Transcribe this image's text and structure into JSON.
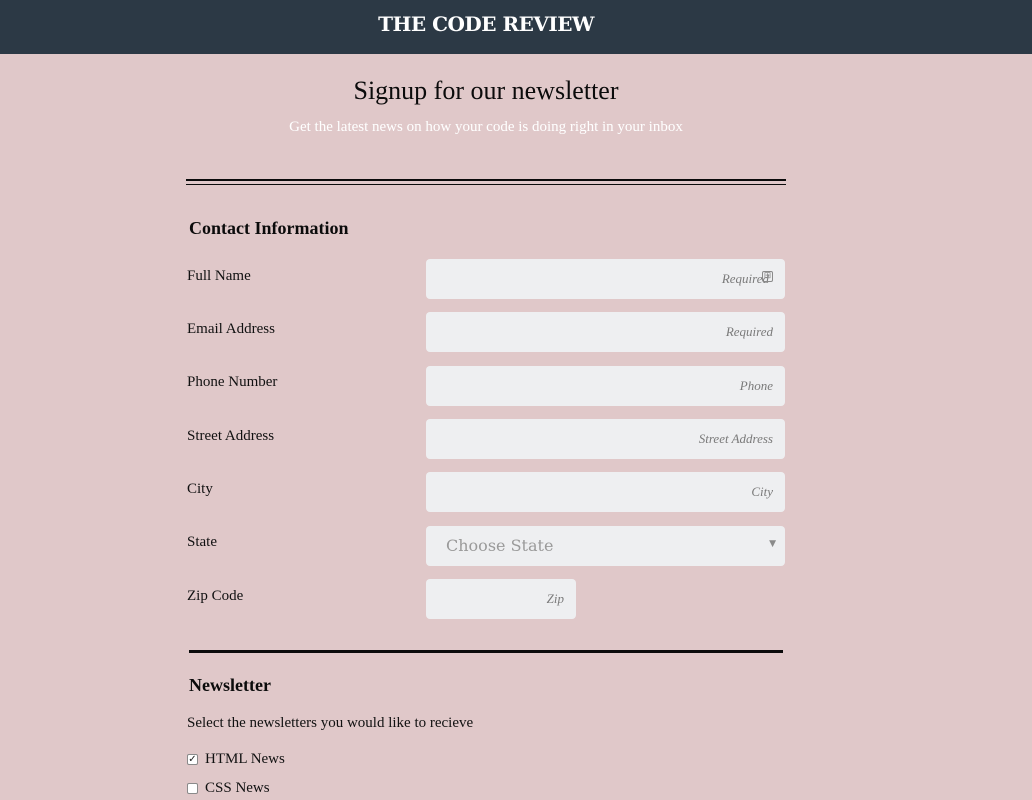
{
  "header": {
    "brand": "THE CODE REVIEW"
  },
  "hero": {
    "title": "Signup for our newsletter",
    "subtitle": "Get the latest news on how your code is doing right in your inbox"
  },
  "contact": {
    "title": "Contact Information",
    "fields": {
      "full_name": {
        "label": "Full Name",
        "placeholder": "Required"
      },
      "email": {
        "label": "Email Address",
        "placeholder": "Required"
      },
      "phone": {
        "label": "Phone Number",
        "placeholder": "Phone"
      },
      "street": {
        "label": "Street Address",
        "placeholder": "Street Address"
      },
      "city": {
        "label": "City",
        "placeholder": "City"
      },
      "state": {
        "label": "State",
        "selected": "Choose State"
      },
      "zip": {
        "label": "Zip Code",
        "placeholder": "Zip"
      }
    }
  },
  "newsletter": {
    "title": "Newsletter",
    "prompt": "Select the newsletters you would like to recieve",
    "options": [
      {
        "label": "HTML News",
        "checked": true
      },
      {
        "label": "CSS News",
        "checked": false
      }
    ]
  },
  "icons": {
    "autofill": "autofill-icon",
    "select_caret": "chevron-down-icon",
    "check": "checkmark-icon"
  },
  "colors": {
    "header_bg": "#2c3945",
    "page_bg": "#e0c8c9",
    "input_bg": "#eeeff1"
  }
}
